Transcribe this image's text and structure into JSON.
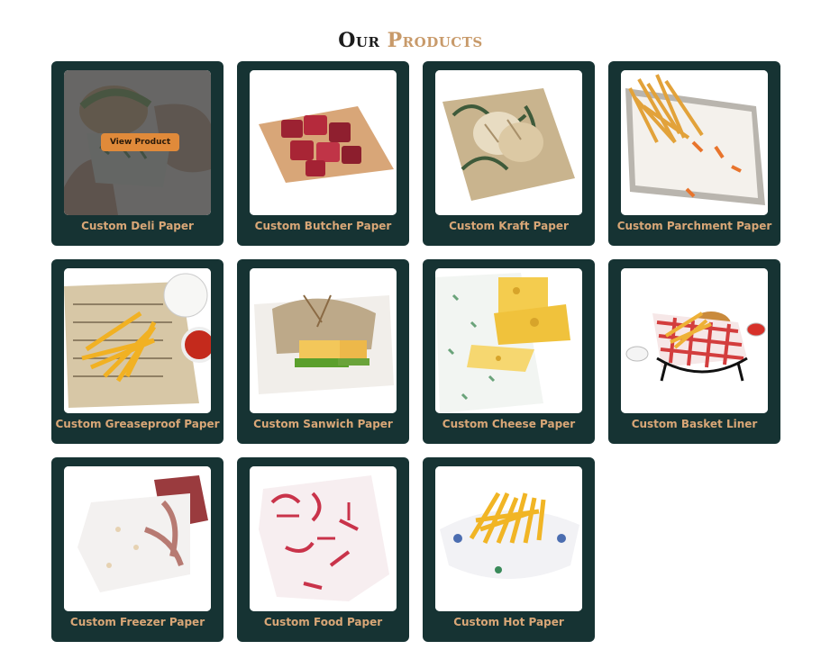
{
  "heading": {
    "word1": "Our",
    "word2": "Products"
  },
  "hover_button": "View Product",
  "colors": {
    "card": "#163333",
    "label": "#d9a777",
    "accent": "#c89a6a",
    "button": "#e08a3a"
  },
  "products": [
    {
      "label": "Custom Deli Paper"
    },
    {
      "label": "Custom Butcher Paper"
    },
    {
      "label": "Custom Kraft Paper"
    },
    {
      "label": "Custom Parchment Paper"
    },
    {
      "label": "Custom Greaseproof Paper"
    },
    {
      "label": "Custom Sanwich Paper"
    },
    {
      "label": "Custom Cheese Paper"
    },
    {
      "label": "Custom Basket Liner"
    },
    {
      "label": "Custom Freezer Paper"
    },
    {
      "label": "Custom Food Paper"
    },
    {
      "label": "Custom Hot Paper"
    }
  ]
}
